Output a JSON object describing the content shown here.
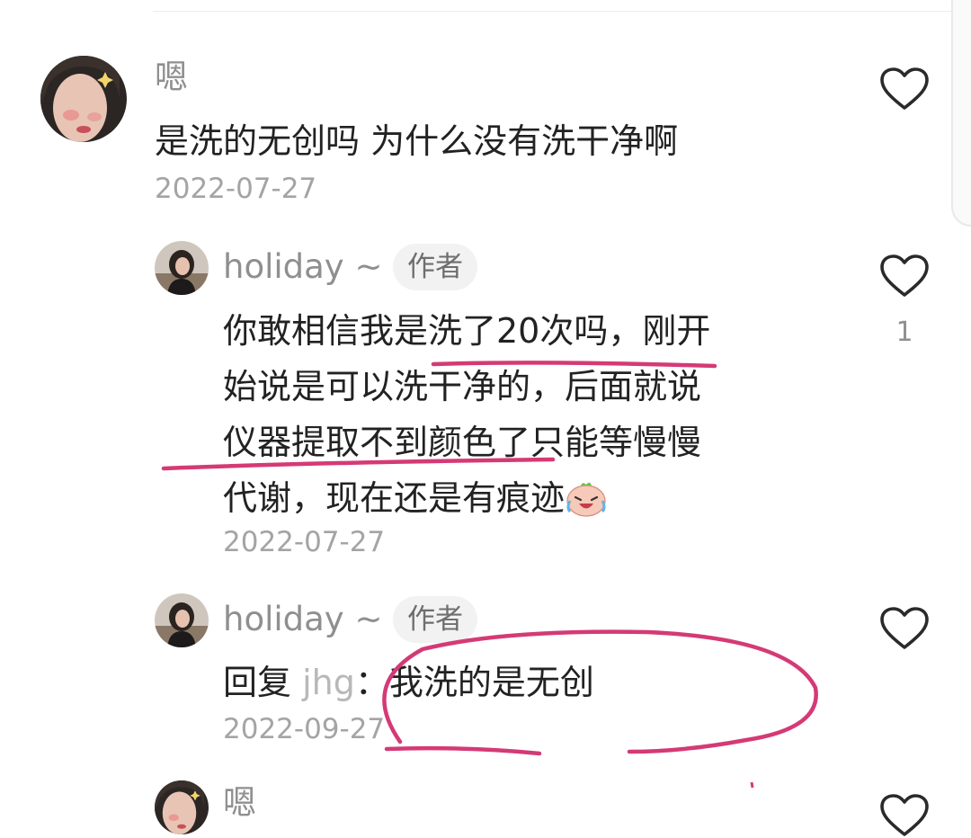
{
  "comments": [
    {
      "username": "嗯",
      "text": "是洗的无创吗 为什么没有洗干净啊",
      "date": "2022-07-27",
      "like_icon": "heart-outline-icon"
    },
    {
      "username": "holiday ~",
      "badge": "作者",
      "text_lines": [
        "你敢相信我是洗了20次吗，刚开",
        "始说是可以洗干净的，后面就说",
        "仪器提取不到颜色了只能等慢慢",
        "代谢，现在还是有痕迹"
      ],
      "emoji": "laughing-crying-face",
      "date": "2022-07-27",
      "like_count": "1",
      "like_icon": "heart-outline-icon"
    },
    {
      "username": "holiday ~",
      "badge": "作者",
      "reply_prefix": "回复",
      "reply_to": "jhg",
      "reply_sep": "：",
      "reply_text": "我洗的是无创",
      "date": "2022-09-27",
      "like_icon": "heart-outline-icon"
    },
    {
      "username": "嗯",
      "like_icon": "heart-outline-icon"
    }
  ],
  "annotation_color": "#d43a76"
}
